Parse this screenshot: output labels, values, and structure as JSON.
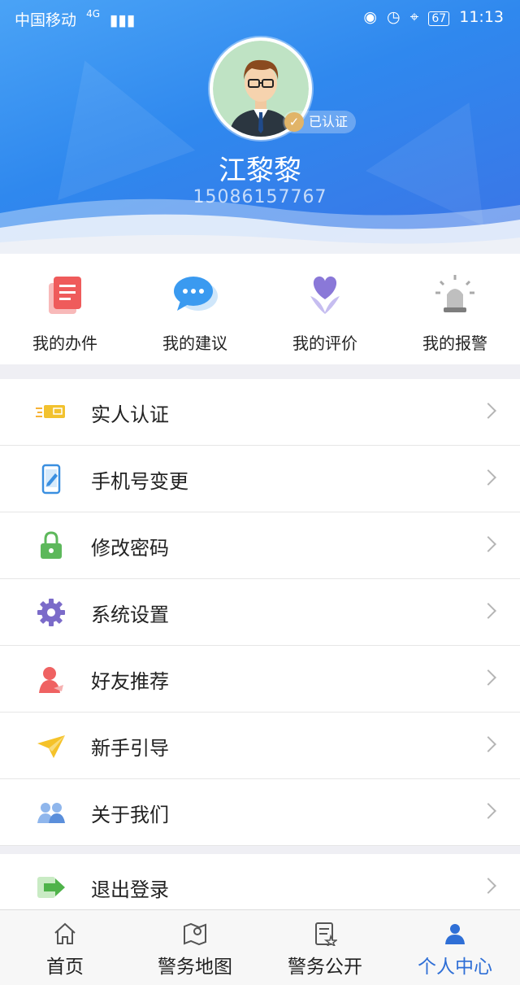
{
  "status_bar": {
    "carrier": "中国移动",
    "network": "4G",
    "battery": "67",
    "time": "11:13"
  },
  "profile": {
    "name": "江黎黎",
    "phone": "15086157767",
    "verified_label": "已认证"
  },
  "quick_actions": [
    {
      "label": "我的办件",
      "icon": "document-icon"
    },
    {
      "label": "我的建议",
      "icon": "chat-bubble-icon"
    },
    {
      "label": "我的评价",
      "icon": "heart-flower-icon"
    },
    {
      "label": "我的报警",
      "icon": "alarm-light-icon"
    }
  ],
  "menu": [
    {
      "label": "实人认证",
      "icon": "id-card-icon"
    },
    {
      "label": "手机号变更",
      "icon": "phone-edit-icon"
    },
    {
      "label": "修改密码",
      "icon": "lock-icon"
    },
    {
      "label": "系统设置",
      "icon": "gear-icon"
    },
    {
      "label": "好友推荐",
      "icon": "person-icon"
    },
    {
      "label": "新手引导",
      "icon": "paper-plane-icon"
    },
    {
      "label": "关于我们",
      "icon": "group-icon"
    }
  ],
  "logout": {
    "label": "退出登录",
    "icon": "exit-arrow-icon"
  },
  "tabs": [
    {
      "label": "首页",
      "icon": "home-icon"
    },
    {
      "label": "警务地图",
      "icon": "map-icon"
    },
    {
      "label": "警务公开",
      "icon": "notice-icon"
    },
    {
      "label": "个人中心",
      "icon": "user-icon"
    }
  ],
  "colors": {
    "accent": "#2f6fd6",
    "header": "#3a8bf0",
    "verified_badge": "#e1b468"
  }
}
